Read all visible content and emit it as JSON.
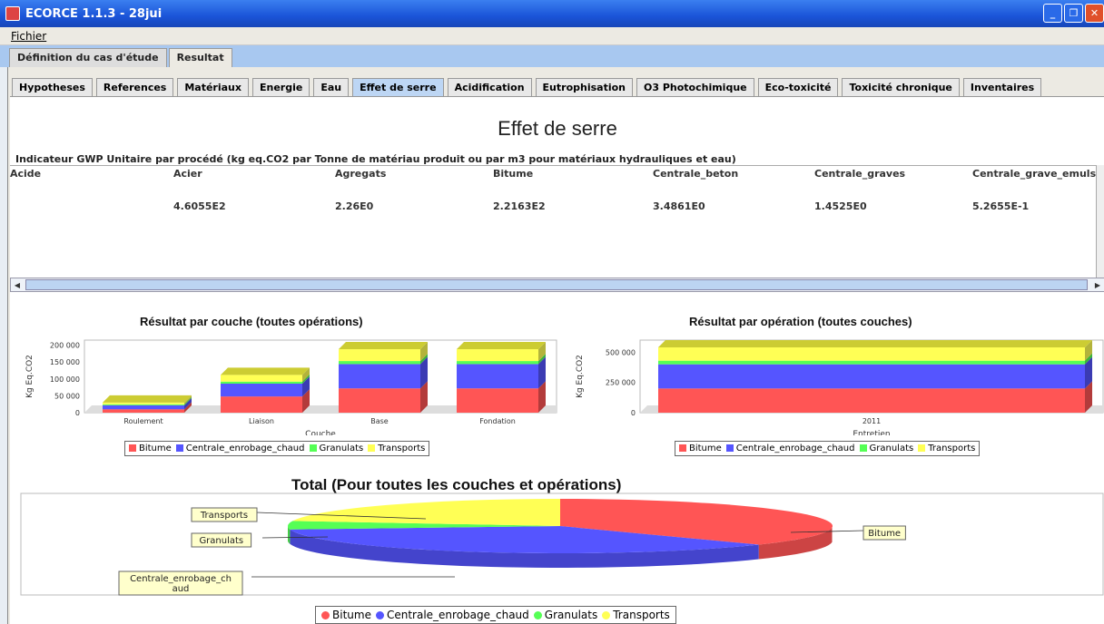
{
  "window": {
    "title": "ECORCE 1.1.3 - 28jui"
  },
  "menu": {
    "file": "Fichier"
  },
  "main_tabs": [
    {
      "label": "Définition du cas d'étude"
    },
    {
      "label": "Resultat"
    }
  ],
  "sub_tabs": [
    {
      "label": "Hypotheses"
    },
    {
      "label": "References"
    },
    {
      "label": "Matériaux"
    },
    {
      "label": "Energie"
    },
    {
      "label": "Eau"
    },
    {
      "label": "Effet de serre"
    },
    {
      "label": "Acidification"
    },
    {
      "label": "Eutrophisation"
    },
    {
      "label": "O3 Photochimique"
    },
    {
      "label": "Eco-toxicité"
    },
    {
      "label": "Toxicité chronique"
    },
    {
      "label": "Inventaires"
    }
  ],
  "page": {
    "title": "Effet de serre",
    "indicator": "Indicateur GWP Unitaire par procédé (kg eq.CO2 par Tonne de matériau produit ou par m3 pour matériaux hydrauliques et eau)"
  },
  "table": {
    "headers": [
      "Acide",
      "Acier",
      "Agregats",
      "Bitume",
      "Centrale_beton",
      "Centrale_graves",
      "Centrale_grave_emulsion"
    ],
    "values": [
      "",
      "4.6055E2",
      "2.26E0",
      "2.2163E2",
      "3.4861E0",
      "1.4525E0",
      "5.2655E-1"
    ]
  },
  "colors": {
    "Bitume": "#ff5555",
    "Centrale_enrobage_chaud": "#5555ff",
    "Granulats": "#55ff55",
    "Transports": "#ffff55"
  },
  "chart_data": [
    {
      "type": "bar",
      "title": "Résultat par couche (toutes opérations)",
      "xlabel": "Couche",
      "ylabel": "Kg Eq.CO2",
      "categories": [
        "Roulement",
        "Liaison",
        "Base",
        "Fondation"
      ],
      "yticks": [
        "0",
        "50 000",
        "100 000",
        "150 000",
        "200 000"
      ],
      "ylim": [
        0,
        215000
      ],
      "stacked": true,
      "series": [
        {
          "name": "Bitume",
          "values": [
            10000,
            48000,
            72000,
            72000
          ]
        },
        {
          "name": "Centrale_enrobage_chaud",
          "values": [
            12000,
            38000,
            72000,
            72000
          ]
        },
        {
          "name": "Granulats",
          "values": [
            3000,
            6000,
            9000,
            9000
          ]
        },
        {
          "name": "Transports",
          "values": [
            5000,
            20000,
            35000,
            35000
          ]
        }
      ]
    },
    {
      "type": "bar",
      "title": "Résultat par opération (toutes couches)",
      "xlabel": "Entretien",
      "ylabel": "Kg Eq.CO2",
      "categories": [
        "2011"
      ],
      "yticks": [
        "0",
        "250 000",
        "500 000"
      ],
      "ylim": [
        0,
        600000
      ],
      "stacked": true,
      "series": [
        {
          "name": "Bitume",
          "values": [
            200000
          ]
        },
        {
          "name": "Centrale_enrobage_chaud",
          "values": [
            200000
          ]
        },
        {
          "name": "Granulats",
          "values": [
            30000
          ]
        },
        {
          "name": "Transports",
          "values": [
            110000
          ]
        }
      ]
    },
    {
      "type": "pie",
      "title": "Total (Pour toutes les couches et opérations)",
      "labels": [
        "Bitume",
        "Centrale_enrobage_chaud",
        "Granulats",
        "Transports"
      ],
      "values": [
        37,
        36,
        5,
        22
      ]
    }
  ],
  "legend": [
    "Bitume",
    "Centrale_enrobage_chaud",
    "Granulats",
    "Transports"
  ],
  "pie_labels": {
    "bitume": "Bitume",
    "centrale": "Centrale_enrobage_ch aud",
    "granulats": "Granulats",
    "transports": "Transports"
  }
}
